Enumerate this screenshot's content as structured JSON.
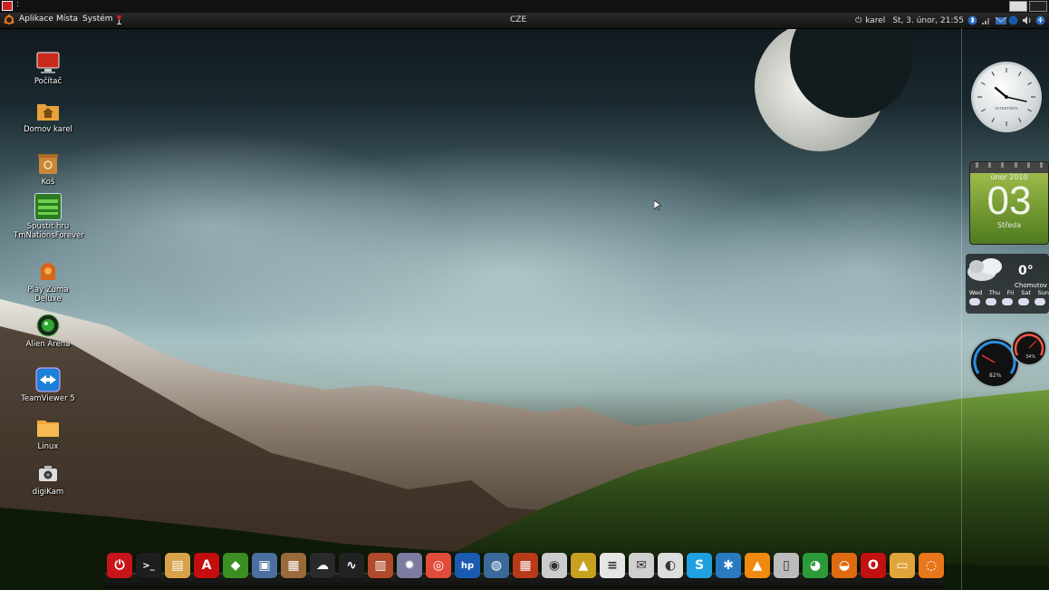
{
  "titlebar": {
    "separator": ":"
  },
  "panel": {
    "menus": [
      "Aplikace",
      "Místa",
      "Systém"
    ],
    "keyboard_layout": "CZE",
    "user": "karel",
    "datetime": "St, 3. únor, 21:55"
  },
  "desktop_icons": [
    {
      "label": "Počítač",
      "icon": "computer-icon"
    },
    {
      "label": "Domov karel",
      "icon": "home-folder-icon"
    },
    {
      "label": "Koš",
      "icon": "trash-icon"
    },
    {
      "label": "Spustit hru TmNationsForever",
      "icon": "game-icon"
    },
    {
      "label": "Play Zuma Deluxe",
      "icon": "zuma-icon"
    },
    {
      "label": "Alien Arena",
      "icon": "alien-arena-icon"
    },
    {
      "label": "TeamViewer 5",
      "icon": "teamviewer-icon"
    },
    {
      "label": "Linux",
      "icon": "folder-icon"
    },
    {
      "label": "digiKam",
      "icon": "camera-icon"
    }
  ],
  "screenlets": {
    "clock": {
      "brand": "screenlets"
    },
    "calendar": {
      "month": "únor 2010",
      "day": "03",
      "weekday": "Středa"
    },
    "weather": {
      "temp": "0°",
      "city": "Chomutov",
      "days": [
        "Wed",
        "Thu",
        "Fri",
        "Sat",
        "Sun"
      ]
    },
    "gauges": {
      "cpu": "82%",
      "mem": "34%"
    }
  },
  "dock": [
    {
      "name": "shutdown-icon",
      "color": "#c8141a",
      "glyph": "⏻"
    },
    {
      "name": "terminal-icon",
      "color": "#1e1e1e",
      "glyph": ">_"
    },
    {
      "name": "image-viewer-icon",
      "color": "#d8a24a",
      "glyph": "▤"
    },
    {
      "name": "pdf-reader-icon",
      "color": "#c40d0d",
      "glyph": "A"
    },
    {
      "name": "game-icon",
      "color": "#3b8e22",
      "glyph": "◆"
    },
    {
      "name": "save-disk-icon",
      "color": "#4a6fa0",
      "glyph": "▣"
    },
    {
      "name": "package-icon",
      "color": "#9a6a3a",
      "glyph": "▦"
    },
    {
      "name": "wine-icon",
      "color": "#2a2a2a",
      "glyph": "☁"
    },
    {
      "name": "system-monitor-icon",
      "color": "#222",
      "glyph": "∿"
    },
    {
      "name": "software-center-icon",
      "color": "#b04a2a",
      "glyph": "▥"
    },
    {
      "name": "settings-icon",
      "color": "#7c7ca0",
      "glyph": "✹"
    },
    {
      "name": "picasa-icon",
      "color": "#e14b3a",
      "glyph": "◎"
    },
    {
      "name": "hp-icon",
      "color": "#1a5bb0",
      "glyph": "hp"
    },
    {
      "name": "network-globe-icon",
      "color": "#3a6a9a",
      "glyph": "◍"
    },
    {
      "name": "firewall-icon",
      "color": "#b83a1a",
      "glyph": "▦"
    },
    {
      "name": "dvd-burner-icon",
      "color": "#ccc",
      "glyph": "◉"
    },
    {
      "name": "media-app-icon",
      "color": "#c8a020",
      "glyph": "▲"
    },
    {
      "name": "document-icon",
      "color": "#e5e5e5",
      "glyph": "≡"
    },
    {
      "name": "mail-icon",
      "color": "#cfcfcf",
      "glyph": "✉"
    },
    {
      "name": "screenshot-icon",
      "color": "#ddd",
      "glyph": "◐"
    },
    {
      "name": "skype-icon",
      "color": "#1fa0e0",
      "glyph": "S"
    },
    {
      "name": "snowflake-icon",
      "color": "#2a7ac0",
      "glyph": "✱"
    },
    {
      "name": "vlc-icon",
      "color": "#f08a10",
      "glyph": "▲"
    },
    {
      "name": "usb-drive-icon",
      "color": "#bbb",
      "glyph": "▯"
    },
    {
      "name": "chrome-icon",
      "color": "#2d9a3a",
      "glyph": "◕"
    },
    {
      "name": "firefox-icon",
      "color": "#e06a10",
      "glyph": "◒"
    },
    {
      "name": "opera-icon",
      "color": "#c41010",
      "glyph": "O"
    },
    {
      "name": "home-folder-icon",
      "color": "#e0a43a",
      "glyph": "▭"
    },
    {
      "name": "ubuntu-icon",
      "color": "#e8761a",
      "glyph": "◌"
    }
  ]
}
